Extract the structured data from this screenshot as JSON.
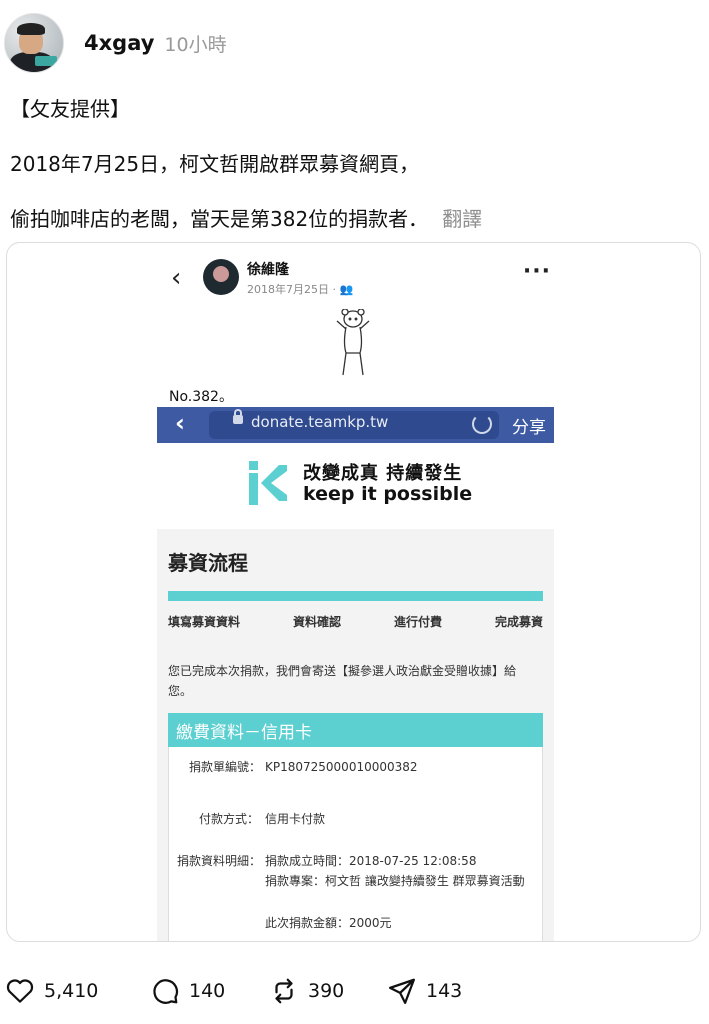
{
  "post": {
    "username": "4xgay",
    "time": "10小時",
    "lines": [
      "【攵友提供】",
      "2018年7月25日，柯文哲開啟群眾募資網頁，",
      "偷拍咖啡店的老闆，當天是第382位的捐款者．"
    ],
    "translate_label": "翻譯"
  },
  "embedded": {
    "fb": {
      "name": "徐維隆",
      "date": "2018年7月25日 ·",
      "caption": "No.382。"
    },
    "site": {
      "url": "donate.teamkp.tw",
      "share_label": "分享",
      "brand_cn": "改變成真 持續發生",
      "brand_en": "keep it possible",
      "flow_title": "募資流程",
      "steps": [
        "填寫募資資料",
        "資料確認",
        "進行付費",
        "完成募資"
      ],
      "done_message": "您已完成本次捐款，我們會寄送【擬參選人政治獻金受贈收據】給您。",
      "pay_header": "繳費資料－信用卡",
      "rows": [
        {
          "label": "捐款單編號：",
          "value": "KP180725000010000382"
        },
        {
          "label": "付款方式：",
          "value": "信用卡付款"
        },
        {
          "label": "捐款資料明細：",
          "value": "捐款成立時間：2018-07-25 12:08:58"
        },
        {
          "label": "",
          "value": "捐款專案：柯文哲 讓改變持續發生 群眾募資活動"
        },
        {
          "label": "",
          "value": "此次捐款金額：2000元"
        }
      ],
      "accent_color": "#5ccfd0",
      "bar_color": "#3d5aa3"
    }
  },
  "actions": {
    "likes": "5,410",
    "comments": "140",
    "reposts": "390",
    "shares": "143"
  }
}
